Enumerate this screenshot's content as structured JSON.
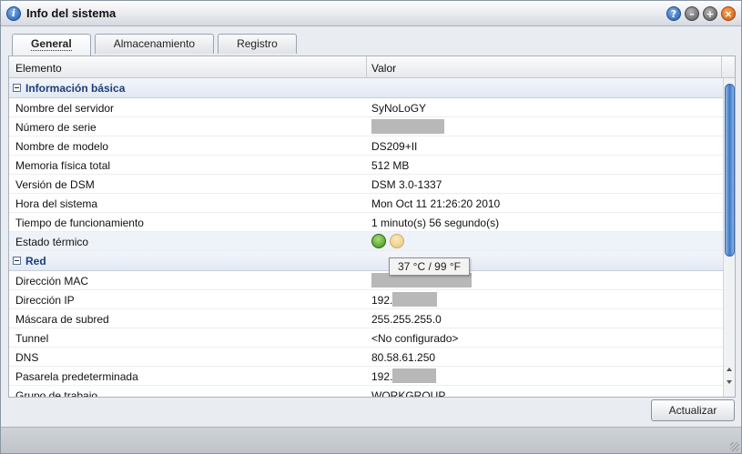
{
  "window": {
    "title": "Info del sistema",
    "buttons": [
      "help-icon",
      "minimize-icon",
      "maximize-icon",
      "close-icon"
    ]
  },
  "tabs": [
    {
      "label": "General",
      "active": true
    },
    {
      "label": "Almacenamiento",
      "active": false
    },
    {
      "label": "Registro",
      "active": false
    }
  ],
  "table": {
    "columns": [
      "Elemento",
      "Valor"
    ],
    "groups": [
      {
        "title": "Información básica",
        "rows": [
          {
            "key": "Nombre del servidor",
            "value": "SyNoLoGY"
          },
          {
            "key": "Número de serie",
            "value": ""
          },
          {
            "key": "Nombre de modelo",
            "value": "DS209+II"
          },
          {
            "key": "Memoria física total",
            "value": "512 MB"
          },
          {
            "key": "Versión de DSM",
            "value": "DSM 3.0-1337"
          },
          {
            "key": "Hora del sistema",
            "value": "Mon Oct 11 21:26:20 2010"
          },
          {
            "key": "Tiempo de funcionamiento",
            "value": "1 minuto(s) 56 segundo(s)"
          },
          {
            "key": "Estado térmico",
            "value": ""
          }
        ]
      },
      {
        "title": "Red",
        "rows": [
          {
            "key": "Dirección MAC",
            "value": ""
          },
          {
            "key": "Dirección IP",
            "value": "192."
          },
          {
            "key": "Máscara de subred",
            "value": "255.255.255.0"
          },
          {
            "key": "Tunnel",
            "value": "<No configurado>"
          },
          {
            "key": "DNS",
            "value": "80.58.61.250"
          },
          {
            "key": "Pasarela predeterminada",
            "value": "192."
          },
          {
            "key": "Grupo de trabajo",
            "value": "WORKGROUP"
          }
        ]
      }
    ]
  },
  "tooltip": "37 °C / 99 °F",
  "footer": {
    "refresh_label": "Actualizar"
  },
  "colors": {
    "thermal_ok": "#3d8a18",
    "accent": "#3c79c8",
    "close": "#d3570f"
  }
}
